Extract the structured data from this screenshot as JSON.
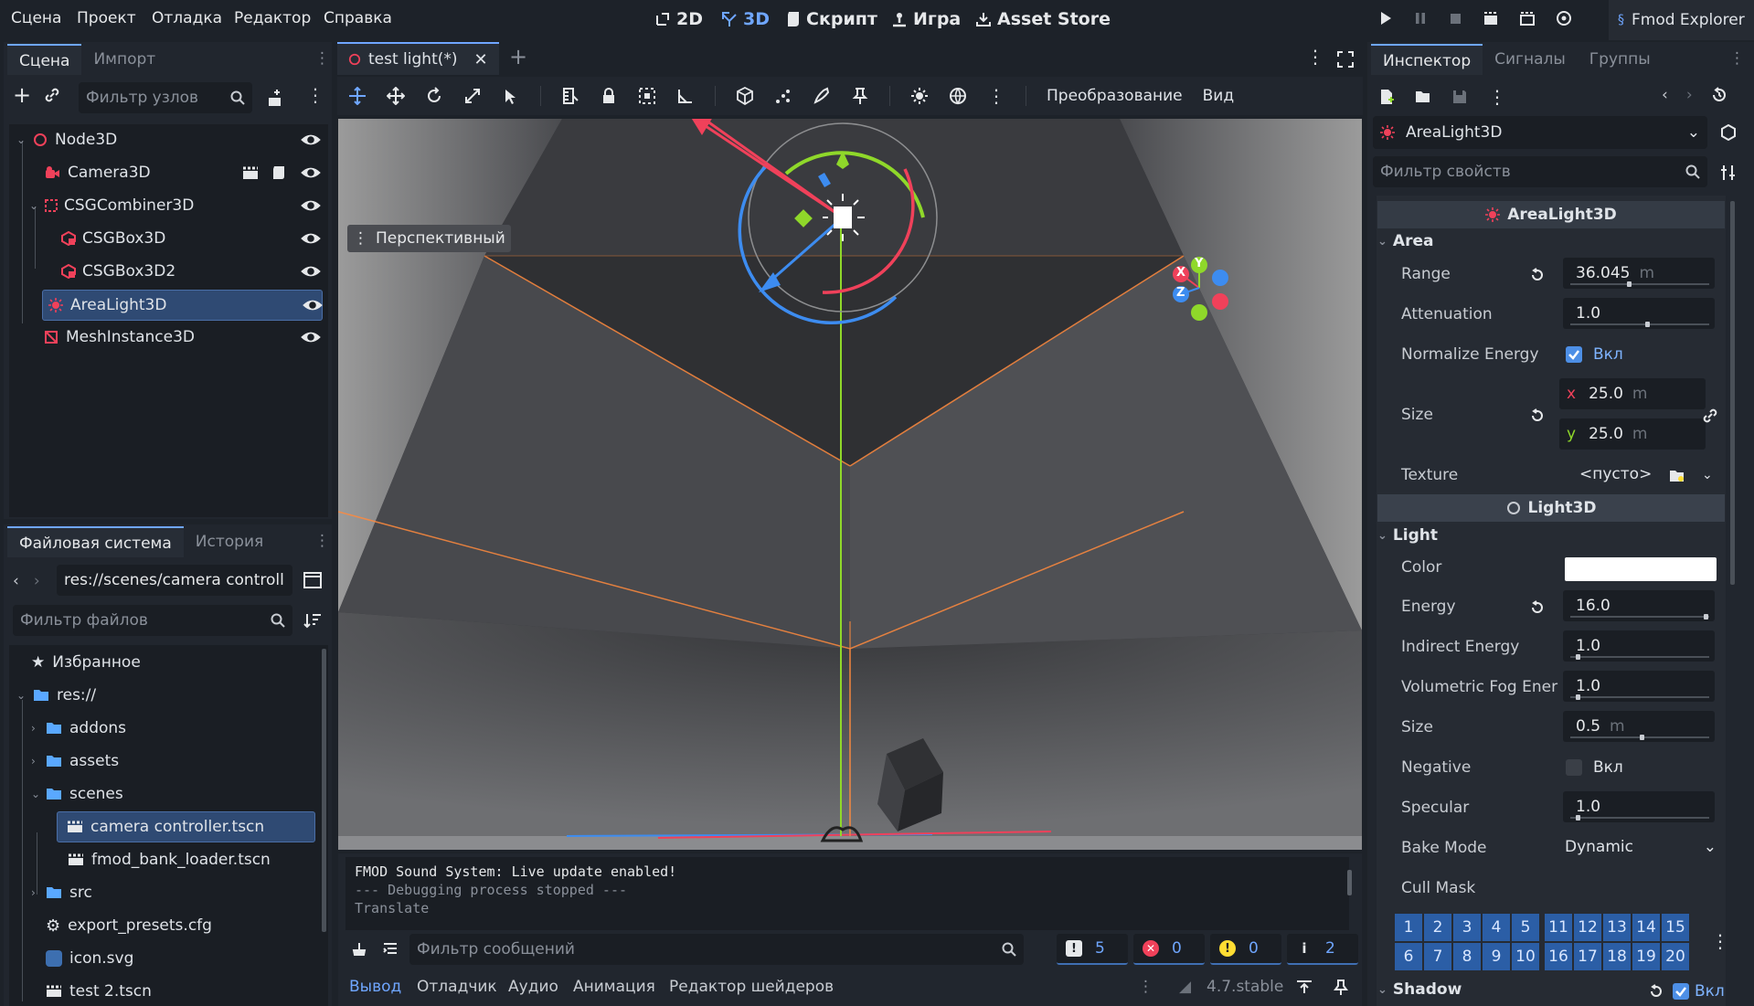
{
  "menu": {
    "items": [
      "Сцена",
      "Проект",
      "Отладка",
      "Редактор",
      "Справка"
    ]
  },
  "modes": {
    "m2d": "2D",
    "m3d": "3D",
    "script": "Скрипт",
    "game": "Игра",
    "asset": "Asset Store"
  },
  "plugin": {
    "label": "Fmod Explorer"
  },
  "scene_dock": {
    "tabs": [
      "Сцена",
      "Импорт"
    ],
    "filter_placeholder": "Фильтр узлов",
    "nodes": [
      {
        "label": "Node3D",
        "icon": "node3d-icon"
      },
      {
        "label": "Camera3D",
        "icon": "camera3d-icon"
      },
      {
        "label": "CSGCombiner3D",
        "icon": "csg-combiner-icon"
      },
      {
        "label": "CSGBox3D",
        "icon": "csg-box-icon"
      },
      {
        "label": "CSGBox3D2",
        "icon": "csg-box-icon"
      },
      {
        "label": "AreaLight3D",
        "icon": "area-light-icon"
      },
      {
        "label": "MeshInstance3D",
        "icon": "mesh-instance-icon"
      }
    ]
  },
  "filesystem": {
    "tabs": [
      "Файловая система",
      "История"
    ],
    "path": "res://scenes/camera controll",
    "filter_placeholder": "Фильтр файлов",
    "items": [
      {
        "label": "Избранное",
        "icon": "star-icon"
      },
      {
        "label": "res://",
        "icon": "folder-icon"
      },
      {
        "label": "addons",
        "icon": "folder-icon"
      },
      {
        "label": "assets",
        "icon": "folder-icon"
      },
      {
        "label": "scenes",
        "icon": "folder-icon"
      },
      {
        "label": "camera controller.tscn",
        "icon": "scene-file-icon"
      },
      {
        "label": "fmod_bank_loader.tscn",
        "icon": "scene-file-icon"
      },
      {
        "label": "src",
        "icon": "folder-icon"
      },
      {
        "label": "export_presets.cfg",
        "icon": "gear-icon"
      },
      {
        "label": "icon.svg",
        "icon": "svg-icon"
      },
      {
        "label": "test 2.tscn",
        "icon": "scene-file-icon"
      }
    ]
  },
  "editor": {
    "tab_label": "test light(*)",
    "viewport_menu_transform": "Преобразование",
    "viewport_menu_view": "Вид",
    "perspective_label": "Перспективный",
    "gizmo_axes": [
      "X",
      "Y",
      "Z"
    ]
  },
  "output": {
    "lines": [
      "FMOD Sound System: Live update enabled!",
      "--- Debugging process stopped ---",
      "Translate"
    ],
    "filter_placeholder": "Фильтр сообщений",
    "counts": {
      "messages": "5",
      "errors": "0",
      "warnings": "0",
      "info": "2"
    },
    "bottom_tabs": [
      "Вывод",
      "Отладчик",
      "Аудио",
      "Анимация",
      "Редактор шейдеров"
    ],
    "version": "4.7.stable"
  },
  "inspector": {
    "tabs": [
      "Инспектор",
      "Сигналы",
      "Группы"
    ],
    "node_name": "AreaLight3D",
    "filter_placeholder": "Фильтр свойств",
    "class_header": "AreaLight3D",
    "area_group": "Area",
    "props": {
      "range_label": "Range",
      "range_value": "36.045",
      "range_unit": "m",
      "attenuation_label": "Attenuation",
      "attenuation_value": "1.0",
      "normalize_label": "Normalize Energy",
      "normalize_value": "Вкл",
      "size_label": "Size",
      "size_x_axis": "x",
      "size_x": "25.0",
      "size_y_axis": "y",
      "size_y": "25.0",
      "size_unit": "m",
      "texture_label": "Texture",
      "texture_value": "<пусто>"
    },
    "light_header": "Light3D",
    "light_group": "Light",
    "light": {
      "color_label": "Color",
      "color_value": "#ffffff",
      "energy_label": "Energy",
      "energy_value": "16.0",
      "indirect_label": "Indirect Energy",
      "indirect_value": "1.0",
      "fog_label": "Volumetric Fog Ener",
      "fog_value": "1.0",
      "lsize_label": "Size",
      "lsize_value": "0.5",
      "lsize_unit": "m",
      "negative_label": "Negative",
      "negative_value": "Вкл",
      "specular_label": "Specular",
      "specular_value": "1.0",
      "bake_label": "Bake Mode",
      "bake_value": "Dynamic",
      "cull_label": "Cull Mask",
      "cull_layers_row1": [
        "1",
        "2",
        "3",
        "4",
        "5",
        "11",
        "12",
        "13",
        "14",
        "15"
      ],
      "cull_layers_row2": [
        "6",
        "7",
        "8",
        "9",
        "10",
        "16",
        "17",
        "18",
        "19",
        "20"
      ],
      "shadow_label": "Shadow",
      "shadow_value": "Вкл"
    }
  },
  "colors": {
    "accent": "#6fa6ff",
    "axis_x": "#f0415a",
    "axis_y": "#8fd82a",
    "axis_z": "#3d8cf0",
    "selection": "#2f4a73"
  }
}
